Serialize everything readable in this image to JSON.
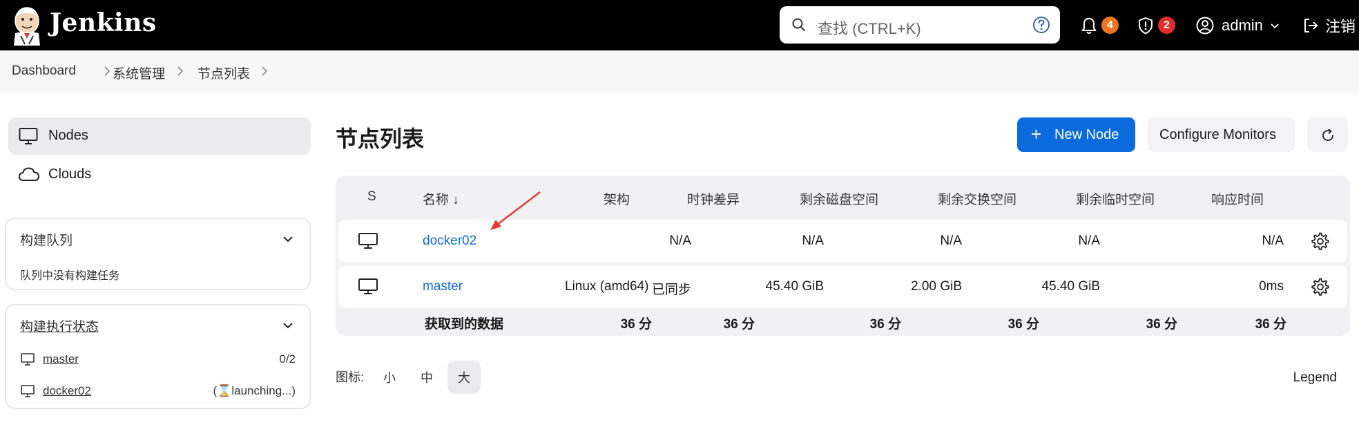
{
  "header": {
    "brand": "Jenkins",
    "search_placeholder": "查找 (CTRL+K)",
    "notifications_count": "4",
    "security_count": "2",
    "user": "admin",
    "logout": "注销",
    "colors": {
      "notif": "#f0751f",
      "security": "#e02c2c"
    }
  },
  "breadcrumb": [
    "Dashboard",
    "系统管理",
    "节点列表"
  ],
  "sidebar": {
    "nav": [
      {
        "label": "Nodes",
        "icon": "computer-icon",
        "active": true
      },
      {
        "label": "Clouds",
        "icon": "cloud-icon",
        "active": false
      }
    ],
    "build_queue": {
      "title": "构建队列",
      "empty": "队列中没有构建任务"
    },
    "executor_status": {
      "title": "构建执行状态",
      "rows": [
        {
          "name": "master",
          "value": "0/2"
        },
        {
          "name": "docker02",
          "value": "(⌛launching...)"
        }
      ]
    }
  },
  "main": {
    "title": "节点列表",
    "new_node": "New Node",
    "configure_monitors": "Configure Monitors",
    "table": {
      "headers": [
        "S",
        "名称 ↓",
        "架构",
        "时钟差异",
        "剩余磁盘空间",
        "剩余交换空间",
        "剩余临时空间",
        "响应时间"
      ],
      "rows": [
        {
          "name": "docker02",
          "arch": "",
          "clock": "N/A",
          "disk": "N/A",
          "swap": "N/A",
          "temp": "N/A",
          "response": "N/A"
        },
        {
          "name": "master",
          "arch": "Linux (amd64)",
          "clock": "已同步",
          "disk": "45.40 GiB",
          "swap": "2.00 GiB",
          "temp": "45.40 GiB",
          "response": "0ms"
        }
      ],
      "footer": {
        "label": "获取到的数据",
        "values": [
          "36 分",
          "36 分",
          "36 分",
          "36 分",
          "36 分",
          "36 分"
        ]
      }
    },
    "icon_size": {
      "label": "图标:",
      "options": [
        "小",
        "中",
        "大"
      ],
      "selected": "大"
    },
    "legend": "Legend"
  }
}
